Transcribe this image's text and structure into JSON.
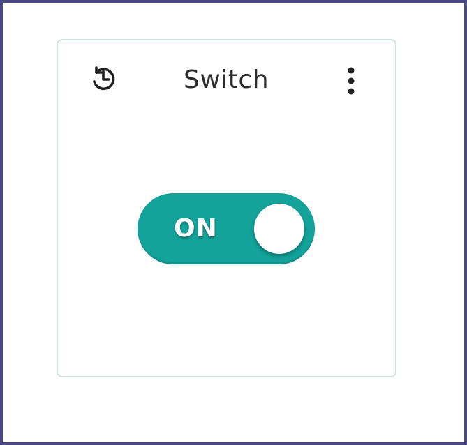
{
  "widget": {
    "title": "Switch",
    "history_icon": "history-icon",
    "more_icon": "more-vertical-icon"
  },
  "toggle": {
    "state_label": "ON",
    "is_on": true,
    "on_color": "#13a39a"
  },
  "colors": {
    "frame_border": "#4a4785",
    "card_border": "#cfe3e1",
    "title_text": "#2b2b2b",
    "icon_color": "#222222"
  }
}
